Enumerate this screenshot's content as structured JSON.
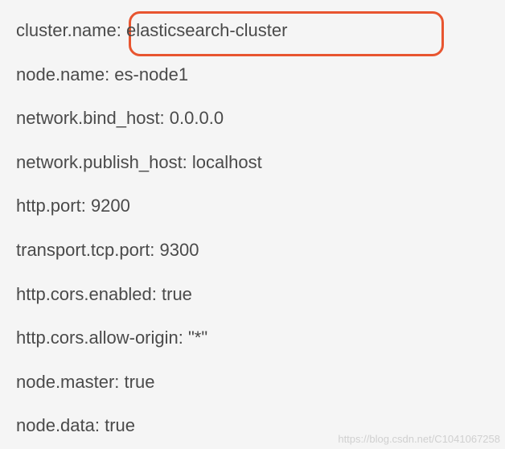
{
  "config": {
    "lines": [
      "cluster.name: elasticsearch-cluster",
      "node.name: es-node1",
      "network.bind_host: 0.0.0.0",
      "network.publish_host: localhost",
      "http.port: 9200",
      "transport.tcp.port: 9300",
      "http.cors.enabled: true",
      "http.cors.allow-origin: \"*\"",
      "node.master: true",
      "node.data: true"
    ]
  },
  "watermark": "https://blog.csdn.net/C1041067258"
}
